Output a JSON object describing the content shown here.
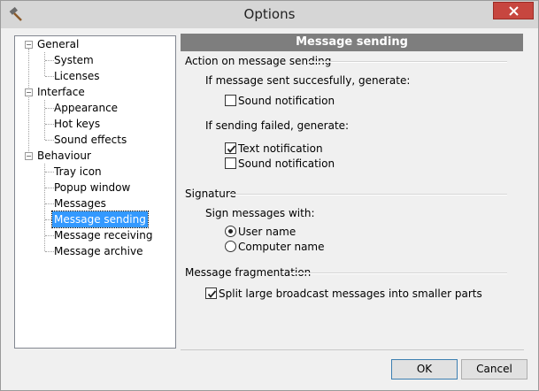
{
  "window": {
    "title": "Options"
  },
  "tree": {
    "nodes": [
      {
        "label": "General",
        "children": [
          "System",
          "Licenses"
        ]
      },
      {
        "label": "Interface",
        "children": [
          "Appearance",
          "Hot keys",
          "Sound effects"
        ]
      },
      {
        "label": "Behaviour",
        "children": [
          "Tray icon",
          "Popup window",
          "Messages",
          "Message sending",
          "Message receiving",
          "Message archive"
        ]
      }
    ],
    "selected": "Message sending",
    "expander_symbol": "−"
  },
  "panel": {
    "header": "Message sending",
    "action_group": {
      "title": "Action on message sending",
      "success_label": "If message sent succesfully, generate:",
      "success_sound": {
        "label": "Sound notification",
        "checked": false
      },
      "failed_label": "If sending failed, generate:",
      "failed_text": {
        "label": "Text notification",
        "checked": true
      },
      "failed_sound": {
        "label": "Sound notification",
        "checked": false
      }
    },
    "signature_group": {
      "title": "Signature",
      "sign_label": "Sign messages with:",
      "options": [
        {
          "label": "User name",
          "selected": true
        },
        {
          "label": "Computer name",
          "selected": false
        }
      ]
    },
    "fragmentation_group": {
      "title": "Message fragmentation",
      "split": {
        "label": "Split large broadcast messages into smaller parts",
        "checked": true
      }
    }
  },
  "buttons": {
    "ok": "OK",
    "cancel": "Cancel"
  }
}
